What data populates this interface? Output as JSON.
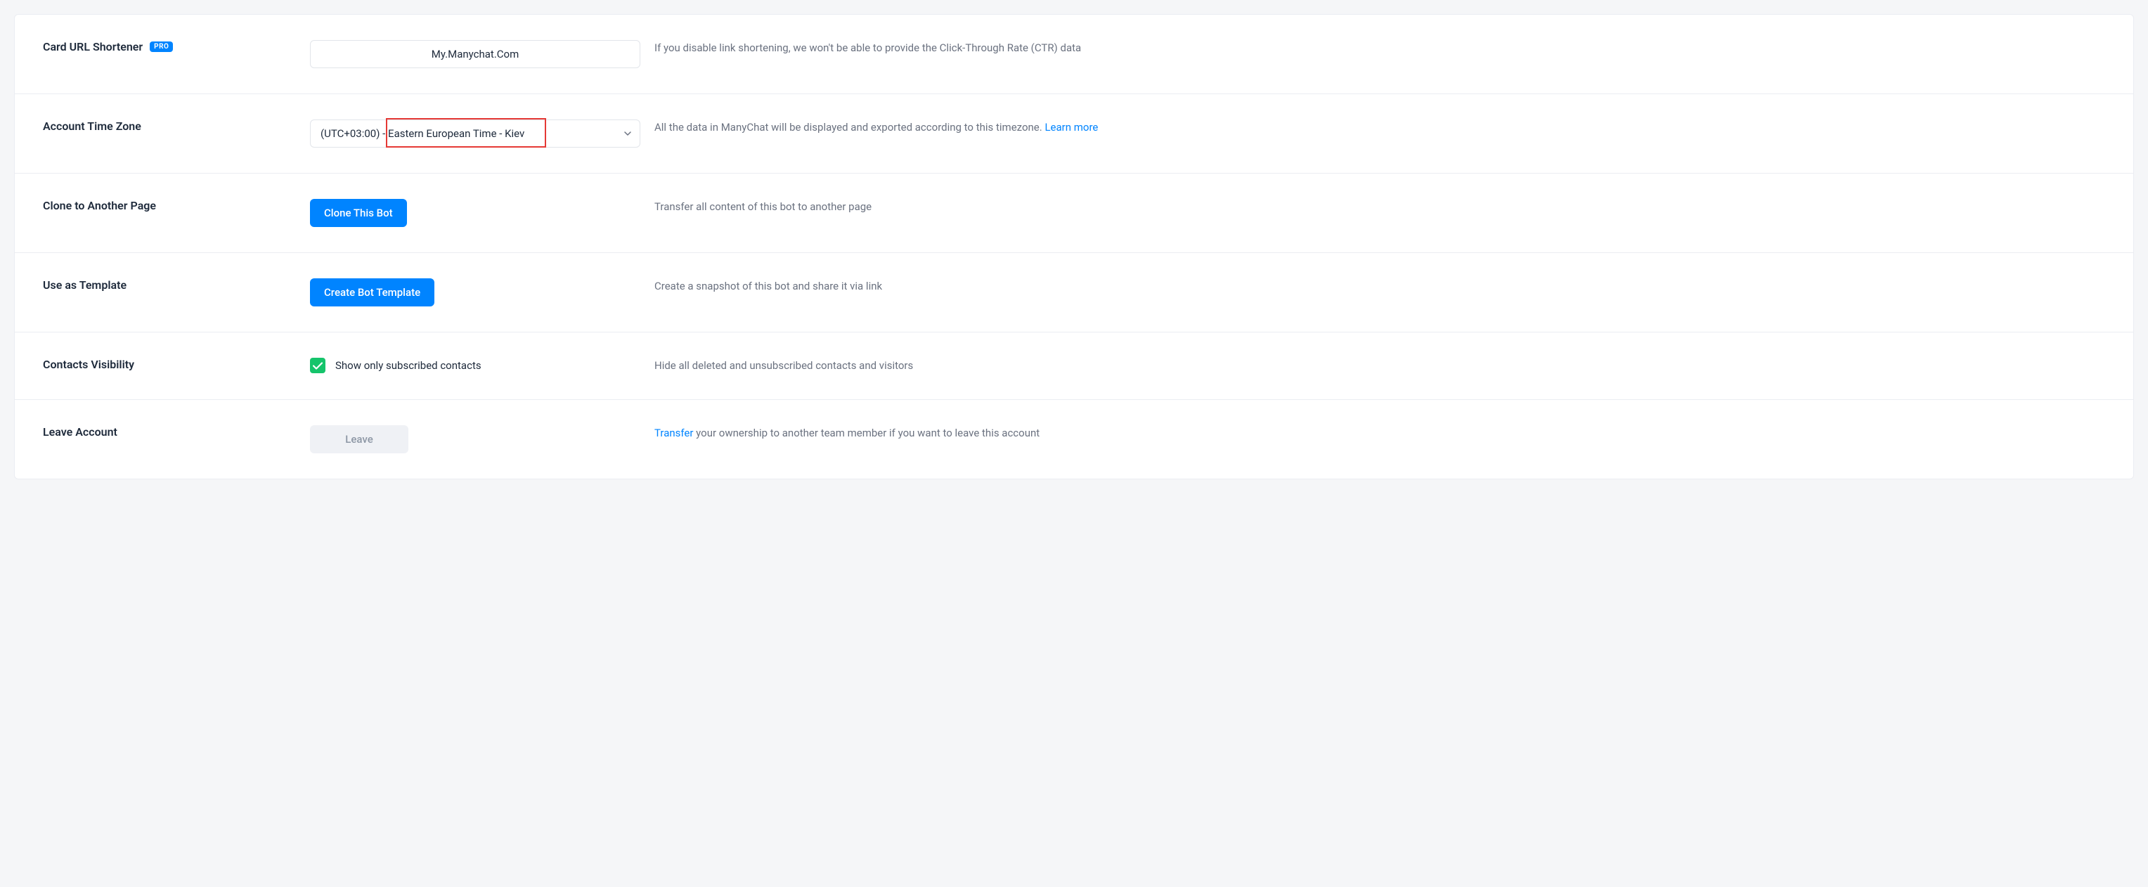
{
  "url_shortener": {
    "label": "Card URL Shortener",
    "badge": "PRO",
    "value": "My.Manychat.Com",
    "desc": "If you disable link shortening, we won't be able to provide the Click-Through Rate (CTR) data"
  },
  "timezone": {
    "label": "Account Time Zone",
    "value": "(UTC+03:00) - Eastern European Time - Kiev",
    "desc": "All the data in ManyChat will be displayed and exported according to this timezone. ",
    "link": "Learn more"
  },
  "clone": {
    "label": "Clone to Another Page",
    "button": "Clone This Bot",
    "desc": "Transfer all content of this bot to another page"
  },
  "template": {
    "label": "Use as Template",
    "button": "Create Bot Template",
    "desc": "Create a snapshot of this bot and share it via link"
  },
  "contacts": {
    "label": "Contacts Visibility",
    "checkbox_label": "Show only subscribed contacts",
    "desc": "Hide all deleted and unsubscribed contacts and visitors"
  },
  "leave": {
    "label": "Leave Account",
    "button": "Leave",
    "link": "Transfer",
    "desc": " your ownership to another team member if you want to leave this account"
  }
}
